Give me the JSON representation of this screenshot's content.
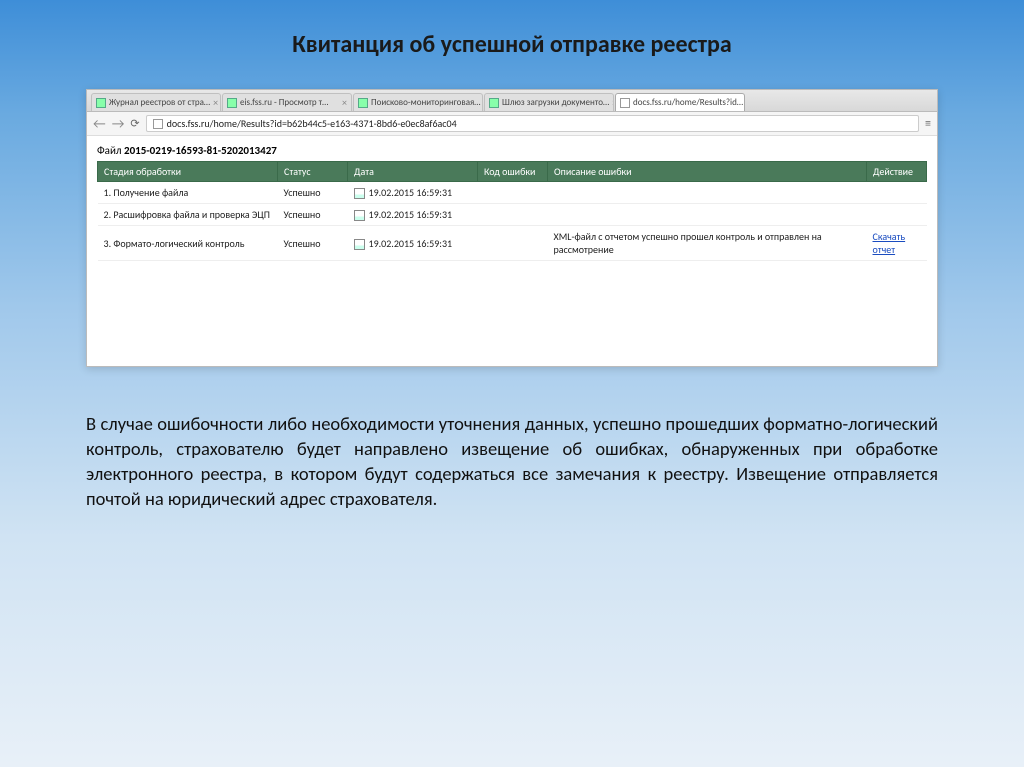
{
  "slide": {
    "title": "Квитанция об успешной отправке реестра",
    "body_text": "В случае ошибочности либо необходимости уточнения данных, успешно прошедших форматно-логический контроль, страхователю будет направлено извещение об ошибках, обнаруженных при обработке электронного реестра, в котором будут содержаться все замечания к реестру. Извещение отправляется почтой на юридический адрес страхователя."
  },
  "browser": {
    "tabs": [
      {
        "label": "Журнал реестров от стра…",
        "active": false
      },
      {
        "label": "eis.fss.ru - Просмотр т…",
        "active": false
      },
      {
        "label": "Поисково-мониторинговая…",
        "active": false
      },
      {
        "label": "Шлюз загрузки документо…",
        "active": false
      },
      {
        "label": "docs.fss.ru/home/Results?id…",
        "active": true
      }
    ],
    "url": "docs.fss.ru/home/Results?id=b62b44c5-e163-4371-8bd6-e0ec8af6ac04"
  },
  "page": {
    "file_prefix": "Файл",
    "file_name": "2015-0219-16593-81-5202013427",
    "columns": {
      "stage": "Стадия обработки",
      "status": "Статус",
      "date": "Дата",
      "err_code": "Код ошибки",
      "err_desc": "Описание ошибки",
      "action": "Действие"
    },
    "rows": [
      {
        "stage": "1. Получение файла",
        "status": "Успешно",
        "date": "19.02.2015 16:59:31",
        "err_code": "",
        "err_desc": "",
        "action": ""
      },
      {
        "stage": "2. Расшифровка файла и проверка ЭЦП",
        "status": "Успешно",
        "date": "19.02.2015 16:59:31",
        "err_code": "",
        "err_desc": "",
        "action": ""
      },
      {
        "stage": "3. Формато-логический контроль",
        "status": "Успешно",
        "date": "19.02.2015 16:59:31",
        "err_code": "",
        "err_desc": "XML-файл с отчетом успешно прошел контроль и отправлен на рассмотрение",
        "action": "Скачать отчет"
      }
    ]
  }
}
